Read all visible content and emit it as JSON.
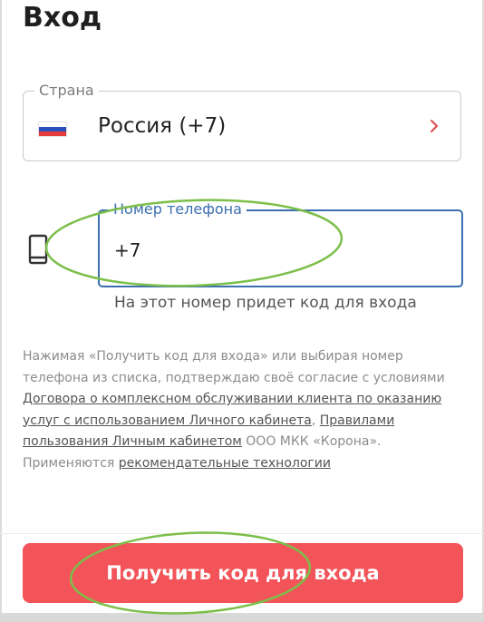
{
  "header": {
    "title": "Вход"
  },
  "country": {
    "label": "Страна",
    "value": "Россия (+7)",
    "flag_icon": "russia-flag-icon",
    "chevron_icon": "chevron-right-icon",
    "chevron_color": "#e0464d"
  },
  "phone": {
    "label": "Номер телефона",
    "value": "+7",
    "hint": "На этот номер придет код для входа",
    "icon": "mobile-phone-icon",
    "accent_color": "#3b6fb0"
  },
  "agreement": {
    "text_1": "Нажимая «Получить код для входа» или выбирая номер телефона из списка, подтверждаю своё согласие с условиями ",
    "link_contract": "Договора о комплексном обслуживании клиента по оказанию услуг с использованием Личного кабинета",
    "text_2": ", ",
    "link_rules": "Правилами пользования Личным кабинетом",
    "text_3": " ООО МКК «Корона».",
    "text_4": "Применяются ",
    "link_tech": "рекомендательные технологии"
  },
  "submit": {
    "label": "Получить код для входа",
    "color": "#f25459"
  },
  "annotations": {
    "highlight_color": "#7cbf4a"
  }
}
